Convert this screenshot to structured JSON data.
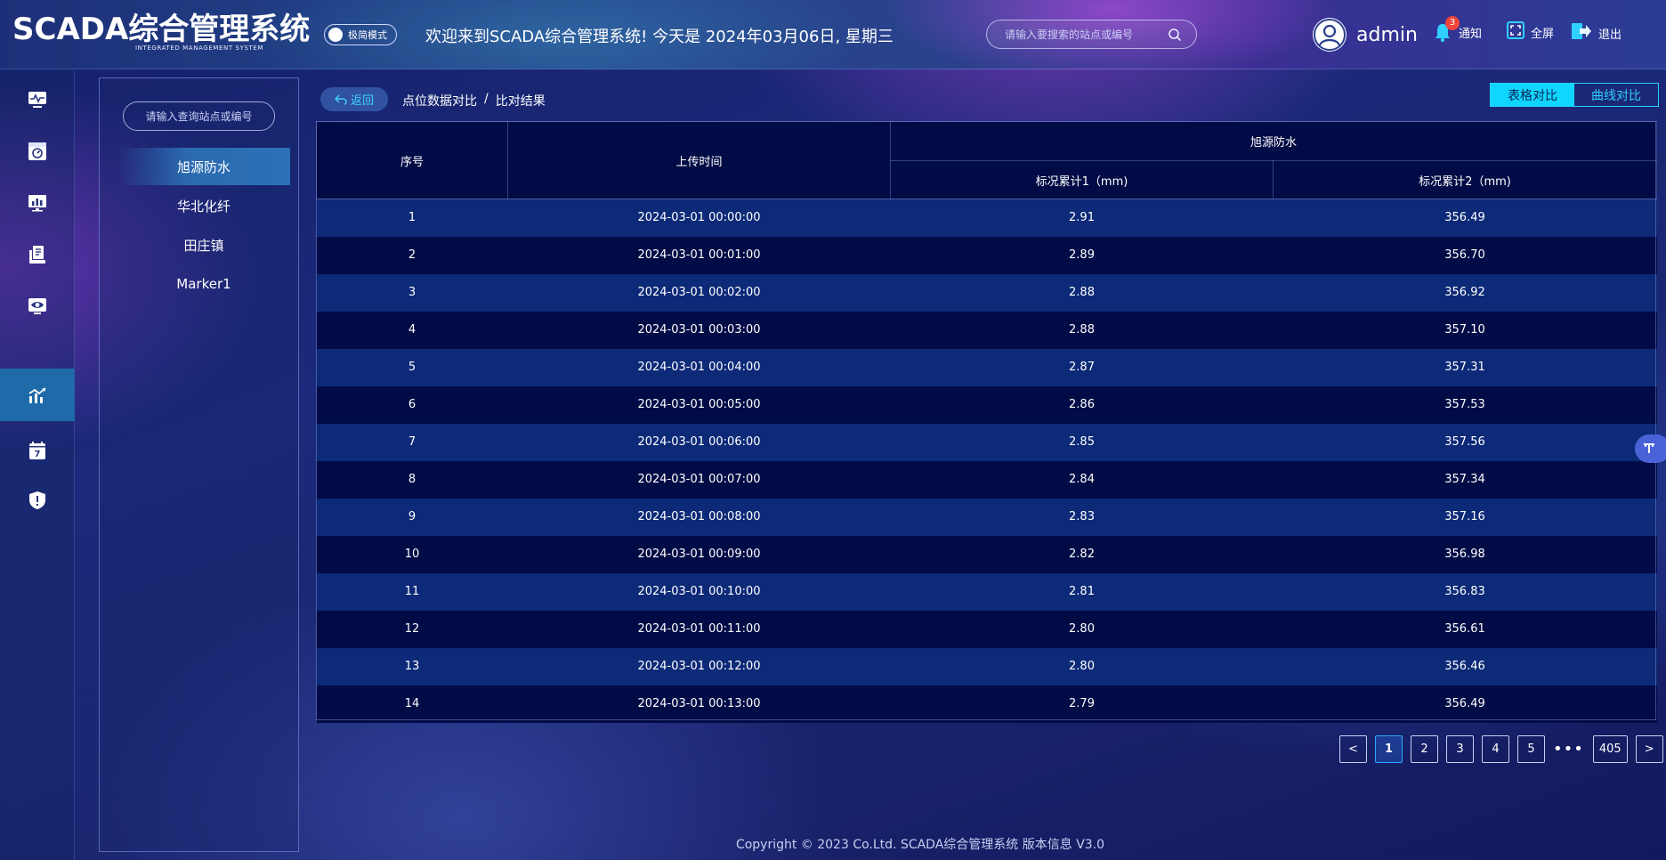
{
  "header": {
    "logo_main": "SCADA综合管理系统",
    "logo_sub": "INTEGRATED MANAGEMENT SYSTEM",
    "mode_toggle_label": "极简模式",
    "welcome": "欢迎来到SCADA综合管理系统!  今天是 2024年03月06日, 星期三",
    "search_placeholder": "请输入要搜索的站点或编号",
    "username": "admin",
    "notify_label": "通知",
    "notify_count": "3",
    "fullscreen_label": "全屏",
    "logout_label": "退出"
  },
  "sidebar": {
    "items": [
      {
        "icon": "monitor-wave-icon"
      },
      {
        "icon": "dashboard-panel-icon"
      },
      {
        "icon": "screen-chart-icon"
      },
      {
        "icon": "report-book-icon"
      },
      {
        "icon": "video-eye-icon"
      },
      {
        "icon": "trend-chart-icon",
        "active": true
      },
      {
        "icon": "calendar-icon"
      },
      {
        "icon": "shield-alert-icon"
      }
    ]
  },
  "stations": {
    "search_placeholder": "请输入查询站点或编号",
    "items": [
      {
        "label": "旭源防水",
        "active": true
      },
      {
        "label": "华北化纤"
      },
      {
        "label": "田庄镇"
      },
      {
        "label": "Marker1"
      }
    ]
  },
  "toolbar": {
    "back_label": "返回",
    "breadcrumb": [
      "点位数据对比",
      "比对结果"
    ],
    "breadcrumb_sep": "/",
    "view_table": "表格对比",
    "view_curve": "曲线对比"
  },
  "table": {
    "col_index": "序号",
    "col_time": "上传时间",
    "group": "旭源防水",
    "col_val1": "标况累计1（mm)",
    "col_val2": "标况累计2（mm)",
    "rows": [
      [
        "1",
        "2024-03-01 00:00:00",
        "2.91",
        "356.49"
      ],
      [
        "2",
        "2024-03-01 00:01:00",
        "2.89",
        "356.70"
      ],
      [
        "3",
        "2024-03-01 00:02:00",
        "2.88",
        "356.92"
      ],
      [
        "4",
        "2024-03-01 00:03:00",
        "2.88",
        "357.10"
      ],
      [
        "5",
        "2024-03-01 00:04:00",
        "2.87",
        "357.31"
      ],
      [
        "6",
        "2024-03-01 00:05:00",
        "2.86",
        "357.53"
      ],
      [
        "7",
        "2024-03-01 00:06:00",
        "2.85",
        "357.56"
      ],
      [
        "8",
        "2024-03-01 00:07:00",
        "2.84",
        "357.34"
      ],
      [
        "9",
        "2024-03-01 00:08:00",
        "2.83",
        "357.16"
      ],
      [
        "10",
        "2024-03-01 00:09:00",
        "2.82",
        "356.98"
      ],
      [
        "11",
        "2024-03-01 00:10:00",
        "2.81",
        "356.83"
      ],
      [
        "12",
        "2024-03-01 00:11:00",
        "2.80",
        "356.61"
      ],
      [
        "13",
        "2024-03-01 00:12:00",
        "2.80",
        "356.46"
      ],
      [
        "14",
        "2024-03-01 00:13:00",
        "2.79",
        "356.49"
      ]
    ]
  },
  "pager": {
    "prev": "<",
    "pages": [
      "1",
      "2",
      "3",
      "4",
      "5"
    ],
    "ellipsis": "•••",
    "last": "405",
    "next": ">",
    "current": "1"
  },
  "footer": "Copyright © 2023 Co.Ltd. SCADA综合管理系统 版本信息 V3.0",
  "colors": {
    "accent_cyan": "#0fd6ff",
    "active_blue": "#1f6aa8",
    "row_dark": "#010b45",
    "row_light": "#0d2a78",
    "badge_red": "#f0453d"
  }
}
